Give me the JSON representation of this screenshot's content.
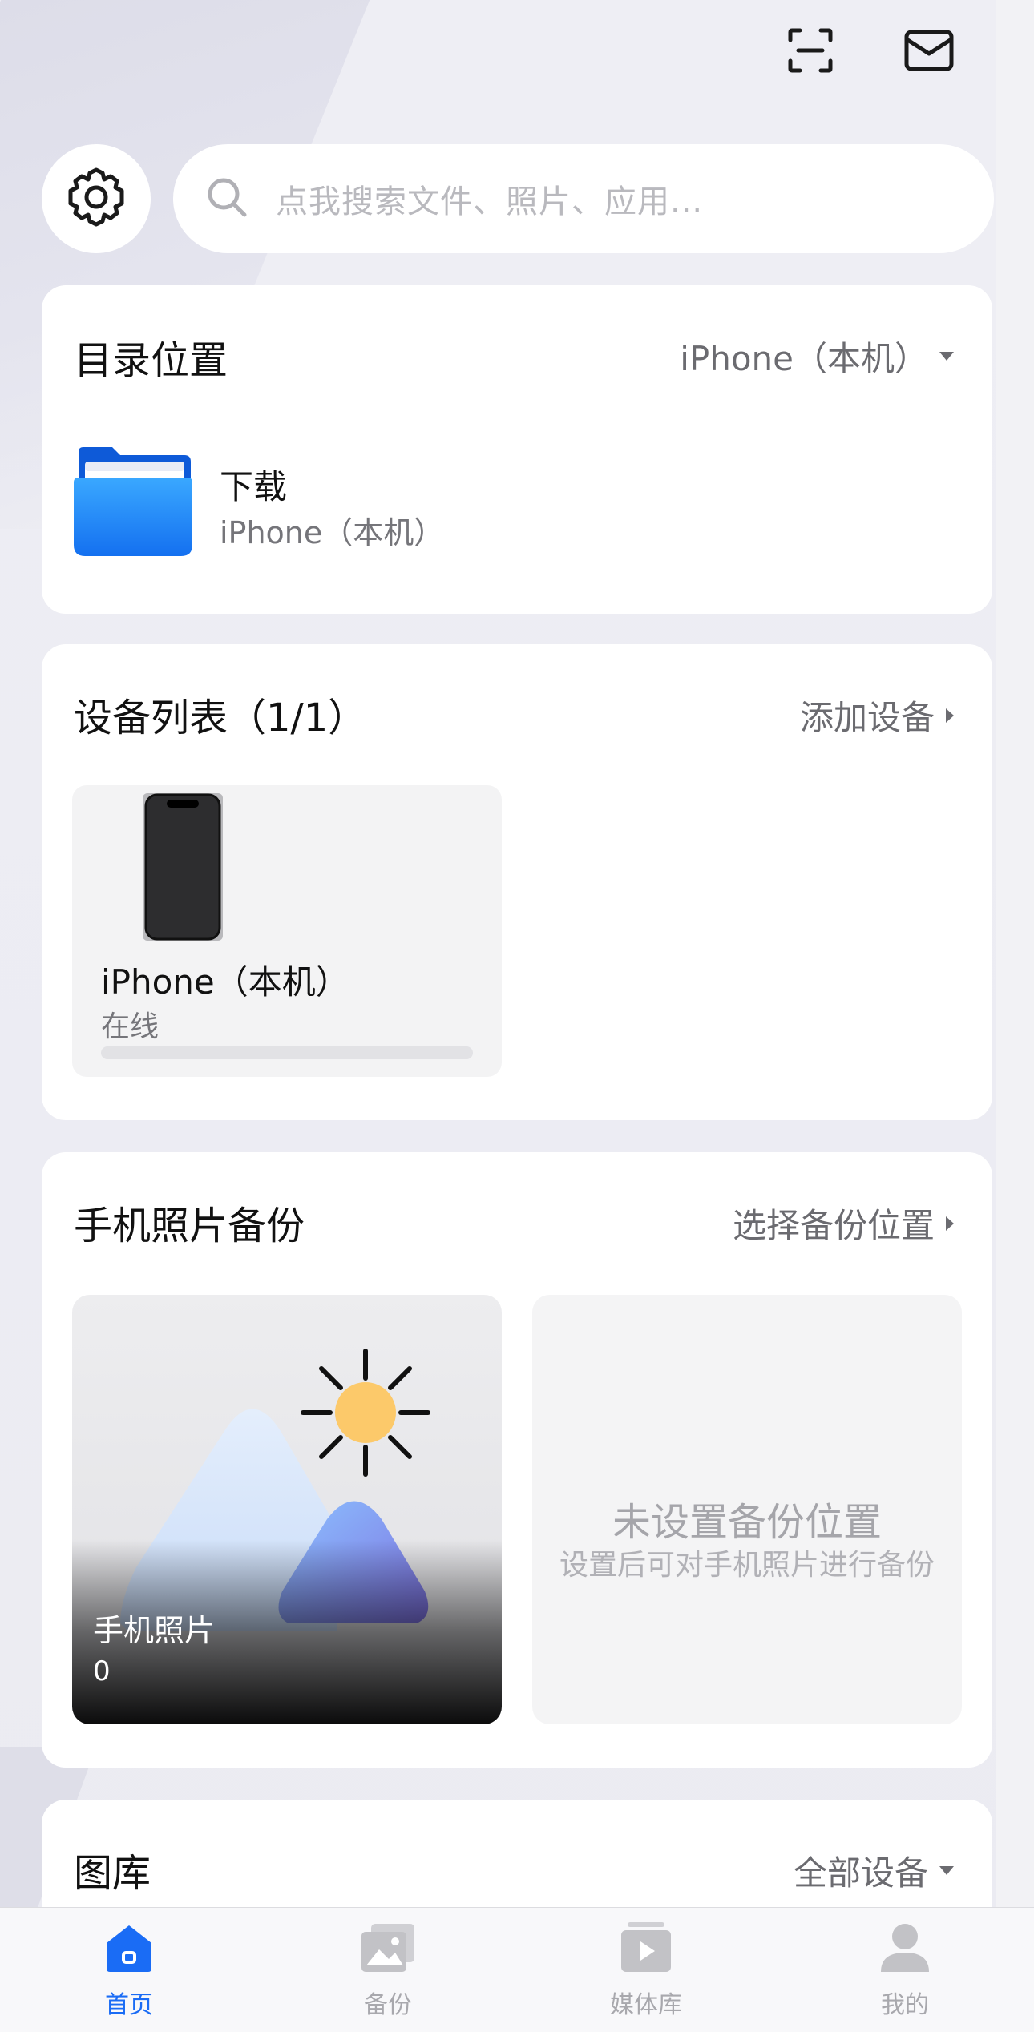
{
  "search": {
    "placeholder": "点我搜索文件、照片、应用..."
  },
  "header": {
    "scan_icon": "scan-icon",
    "mail_icon": "mail-icon",
    "settings_icon": "gear-icon"
  },
  "directory": {
    "title": "目录位置",
    "selector": "iPhone（本机）",
    "folder_name": "下载",
    "folder_location": "iPhone（本机）"
  },
  "devices": {
    "title": "设备列表（1/1）",
    "action": "添加设备",
    "items": [
      {
        "name": "iPhone（本机）",
        "status": "在线"
      }
    ]
  },
  "backup": {
    "title": "手机照片备份",
    "action": "选择备份位置",
    "photos_label": "手机照片",
    "photos_count": "0",
    "empty_title": "未设置备份位置",
    "empty_sub": "设置后可对手机照片进行备份"
  },
  "gallery": {
    "title": "图库",
    "selector": "全部设备"
  },
  "tabbar": {
    "items": [
      {
        "label": "首页",
        "icon": "home-icon",
        "active": true
      },
      {
        "label": "备份",
        "icon": "photo-backup-icon",
        "active": false
      },
      {
        "label": "媒体库",
        "icon": "media-library-icon",
        "active": false
      },
      {
        "label": "我的",
        "icon": "profile-icon",
        "active": false
      }
    ]
  },
  "colors": {
    "accent": "#1a6cf5",
    "background": "#ececf3",
    "card": "#ffffff",
    "sun": "#fcc96a"
  }
}
